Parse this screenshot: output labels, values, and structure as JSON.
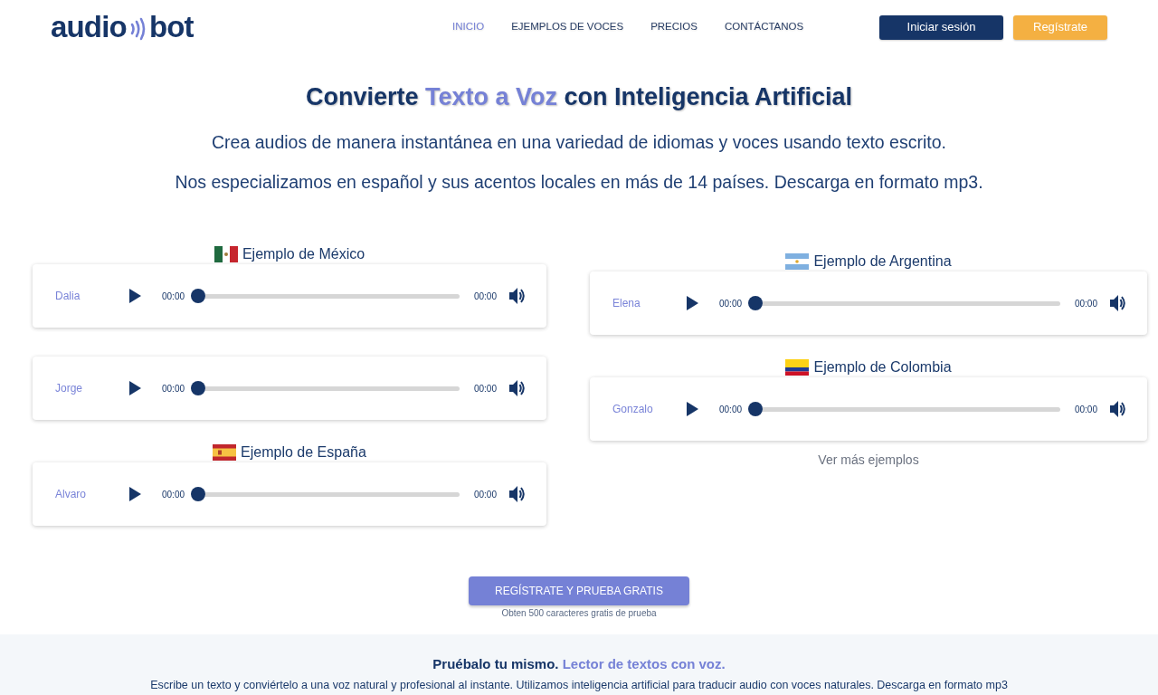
{
  "header": {
    "logo": {
      "left": "audio",
      "right": "bot"
    },
    "nav": [
      {
        "label": "INICIO",
        "selected": true
      },
      {
        "label": "EJEMPLOS DE VOCES",
        "selected": false
      },
      {
        "label": "PRECIOS",
        "selected": false
      },
      {
        "label": "CONTÁCTANOS",
        "selected": false
      }
    ],
    "buttons": [
      {
        "label": "Iniciar sesión",
        "kind": "primary"
      },
      {
        "label": "Regístrate",
        "kind": "accent"
      }
    ]
  },
  "hero": {
    "title": [
      {
        "text": "Convierte ",
        "highlight": false
      },
      {
        "text": "Texto a Voz",
        "highlight": true
      },
      {
        "text": " con Inteligencia Artificial",
        "highlight": false
      }
    ],
    "lines": [
      "Crea audios de manera instantánea en una variedad de idiomas y voces usando texto escrito.",
      "Nos especializamos en español y sus acentos locales en más de 14 países. Descarga en formato mp3."
    ]
  },
  "examples": {
    "columns": [
      {
        "groups": [
          {
            "kind": "mexico",
            "title": "Ejemplo de México",
            "players": [
              {
                "name": "Dalia",
                "current": "00:00",
                "duration": "00:00",
                "level": 0
              },
              {
                "name": "Jorge",
                "current": "00:00",
                "duration": "00:00",
                "level": 0
              }
            ]
          },
          {
            "kind": "spain",
            "title": "Ejemplo de España",
            "players": [
              {
                "name": "Alvaro",
                "current": "00:00",
                "duration": "00:00",
                "level": 0
              }
            ]
          }
        ]
      },
      {
        "groups": [
          {
            "kind": "argentina",
            "title": "Ejemplo de Argentina",
            "players": [
              {
                "name": "Elena",
                "current": "00:00",
                "duration": "00:00",
                "level": 0
              }
            ]
          },
          {
            "kind": "colombia",
            "title": "Ejemplo de Colombia",
            "players": [
              {
                "name": "Gonzalo",
                "current": "00:00",
                "duration": "00:00",
                "level": 0
              }
            ]
          }
        ],
        "link": "Ver más ejemplos"
      }
    ]
  },
  "cta": {
    "button": "REGÍSTRATE Y PRUEBA GRATIS",
    "note": "Obten 500 caracteres gratis de prueba"
  },
  "try_section": {
    "title": [
      {
        "text": "Pruébalo tu mismo. ",
        "highlight": false
      },
      {
        "text": "Lector de textos con voz.",
        "highlight": true
      }
    ],
    "text": "Escribe un texto y conviértelo a una voz natural y profesional al instante. Utilizamos inteligencia artificial para traducir audio con voces naturales. Descarga en formato mp3"
  }
}
